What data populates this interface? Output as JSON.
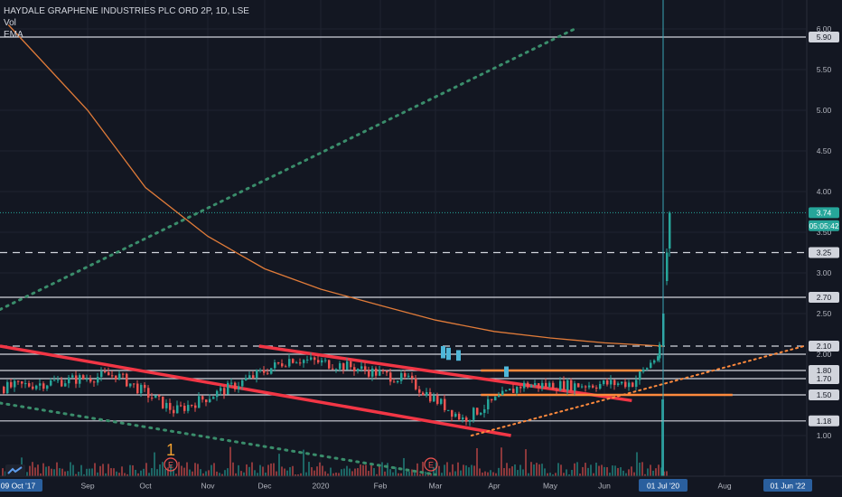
{
  "legend": {
    "title": "HAYDALE GRAPHENE INDUSTRIES PLC ORD 2P, 1D, LSE",
    "vol": "Vol",
    "ema": "EMA"
  },
  "price_axis": {
    "ticks": [
      "6.00",
      "5.50",
      "5.00",
      "4.50",
      "4.00",
      "3.50",
      "3.00",
      "2.50",
      "2.00",
      "1.50",
      "1.00"
    ],
    "labels": [
      {
        "value": 5.9,
        "text": "5.90",
        "style": "white"
      },
      {
        "value": 3.74,
        "text": "3.74",
        "style": "green"
      },
      {
        "value": 3.58,
        "text": "05:05:42",
        "style": "green"
      },
      {
        "value": 3.25,
        "text": "3.25",
        "style": "white"
      },
      {
        "value": 2.7,
        "text": "2.70",
        "style": "white"
      },
      {
        "value": 2.1,
        "text": "2.10",
        "style": "white"
      },
      {
        "value": 1.8,
        "text": "1.80",
        "style": "white"
      },
      {
        "value": 1.7,
        "text": "1.70",
        "style": "white"
      },
      {
        "value": 1.5,
        "text": "1.50",
        "style": "white"
      },
      {
        "value": 1.18,
        "text": "1.18",
        "style": "white"
      }
    ]
  },
  "time_axis": {
    "labels": [
      "09 Oct '17",
      "Sep",
      "Oct",
      "Nov",
      "Dec",
      "2020",
      "Feb",
      "Mar",
      "Apr",
      "May",
      "Jun",
      "01 Jul '20",
      "Aug",
      "01 Jun '22"
    ],
    "highlighted": [
      "09 Oct '17",
      "01 Jul '20",
      "01 Jun '22"
    ]
  },
  "event_markers": [
    "E",
    "E"
  ],
  "annotation": "1",
  "colors": {
    "background": "#131722",
    "up": "#26a69a",
    "down": "#ef5350",
    "ema": "#e07b39",
    "trend_red": "#f23645",
    "trend_orange": "#ff8a3d",
    "dotted_green": "#3a8d6b",
    "cursor": "#3aa6b5"
  },
  "chart_data": {
    "type": "candlestick",
    "title": "HAYDALE GRAPHENE INDUSTRIES PLC ORD 2P, 1D, LSE",
    "ylim": [
      0.5,
      6.1
    ],
    "horizontal_levels": {
      "solid": [
        5.9,
        2.7,
        2.0,
        1.8,
        1.7,
        1.5,
        1.18
      ],
      "dashed": [
        3.25,
        2.1
      ],
      "dotted_last_price": 3.74
    },
    "last_price": 3.74,
    "ema_line": [
      {
        "x": "2019-08-01",
        "y": 6.05
      },
      {
        "x": "2019-09-01",
        "y": 5.0
      },
      {
        "x": "2019-10-01",
        "y": 4.05
      },
      {
        "x": "2019-11-01",
        "y": 3.45
      },
      {
        "x": "2019-12-01",
        "y": 3.05
      },
      {
        "x": "2020-01-01",
        "y": 2.8
      },
      {
        "x": "2020-02-01",
        "y": 2.6
      },
      {
        "x": "2020-03-01",
        "y": 2.42
      },
      {
        "x": "2020-04-01",
        "y": 2.28
      },
      {
        "x": "2020-05-01",
        "y": 2.2
      },
      {
        "x": "2020-06-01",
        "y": 2.14
      },
      {
        "x": "2020-07-01",
        "y": 2.1
      }
    ],
    "trendlines": [
      {
        "style": "red",
        "from": {
          "x": "2019-07-25",
          "y": 2.1
        },
        "to": {
          "x": "2020-04-10",
          "y": 1.0
        }
      },
      {
        "style": "red",
        "from": {
          "x": "2019-11-28",
          "y": 2.1
        },
        "to": {
          "x": "2020-06-15",
          "y": 1.43
        }
      },
      {
        "style": "orange",
        "from": {
          "x": "2020-03-25",
          "y": 1.8
        },
        "to": {
          "x": "2020-06-20",
          "y": 1.8
        }
      },
      {
        "style": "orange",
        "from": {
          "x": "2020-03-25",
          "y": 1.5
        },
        "to": {
          "x": "2020-08-05",
          "y": 1.5
        }
      },
      {
        "style": "dotted-green",
        "from": {
          "x": "2019-07-25",
          "y": 2.55
        },
        "to": {
          "x": "2020-05-15",
          "y": 6.0
        }
      },
      {
        "style": "dotted-green",
        "from": {
          "x": "2019-07-25",
          "y": 1.4
        },
        "to": {
          "x": "2020-03-01",
          "y": 0.52
        }
      },
      {
        "style": "dotted-orange",
        "from": {
          "x": "2020-03-20",
          "y": 1.0
        },
        "to": {
          "x": "2020-09-10",
          "y": 2.1
        }
      }
    ],
    "candles_approx": [
      {
        "x": "2019-08",
        "close": 1.62
      },
      {
        "x": "2019-09",
        "close": 1.75
      },
      {
        "x": "2019-10",
        "close": 1.3
      },
      {
        "x": "2019-11",
        "close": 1.62
      },
      {
        "x": "2019-12",
        "close": 1.95
      },
      {
        "x": "2020-01",
        "close": 1.85
      },
      {
        "x": "2020-02",
        "close": 1.68
      },
      {
        "x": "2020-03",
        "close": 1.2
      },
      {
        "x": "2020-04",
        "close": 1.62
      },
      {
        "x": "2020-05",
        "close": 1.62
      },
      {
        "x": "2020-06",
        "close": 1.65
      },
      {
        "x": "2020-06-30",
        "close": 2.05
      },
      {
        "x": "2020-07-01",
        "close": 3.74
      }
    ]
  }
}
